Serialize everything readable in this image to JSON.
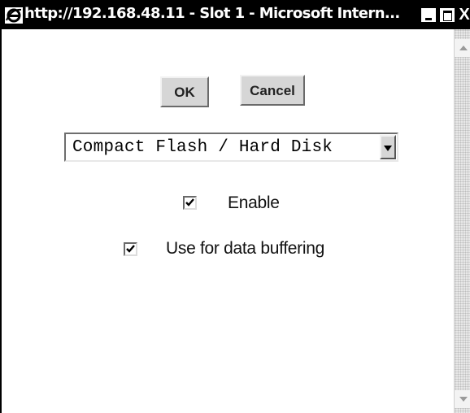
{
  "window": {
    "title": "http://192.168.48.11 - Slot 1 - Microsoft Intern...",
    "icon": "internet-explorer-icon",
    "controls": {
      "minimize": "minimize-icon",
      "maximize": "maximize-icon",
      "close_glyph": "X"
    }
  },
  "form": {
    "ok_label": "OK",
    "cancel_label": "Cancel",
    "storage_select": {
      "selected": "Compact Flash / Hard Disk"
    },
    "enable": {
      "label": "Enable",
      "checked": true
    },
    "data_buffering": {
      "label": "Use for data buffering",
      "checked": true
    }
  },
  "scrollbar": {
    "up_icon": "scroll-up-icon",
    "down_icon": "scroll-down-icon"
  },
  "colors": {
    "titlebar_bg": "#000000",
    "button_face": "#d6d6d6",
    "window_bg": "#ffffff"
  }
}
